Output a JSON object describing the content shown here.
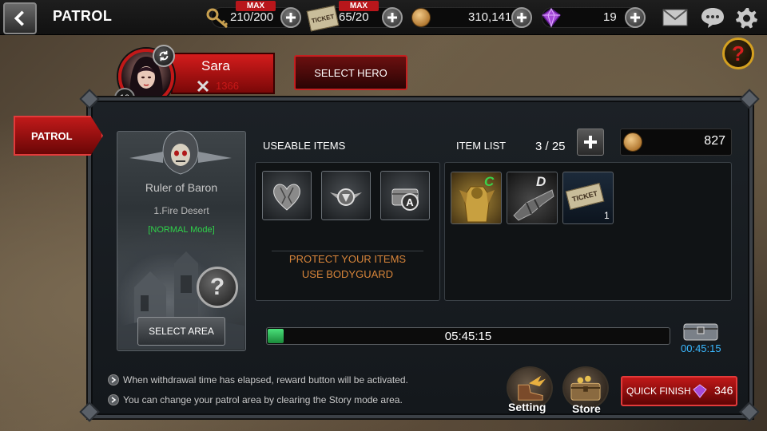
{
  "header": {
    "title": "PATROL",
    "keys": {
      "value": "210/200",
      "max_label": "MAX"
    },
    "tickets": {
      "value": "65/20",
      "max_label": "MAX",
      "icon_text": "TICKET"
    },
    "gold": {
      "value": "310,141"
    },
    "gems": {
      "value": "19"
    }
  },
  "hero": {
    "name": "Sara",
    "power": "1366",
    "level": "10",
    "select_label": "SELECT HERO"
  },
  "side_tab": {
    "label": "PATROL"
  },
  "area": {
    "boss_name": "Ruler of Baron",
    "stage": "1.Fire Desert",
    "mode": "[NORMAL Mode]",
    "help_glyph": "?",
    "select_label": "SELECT AREA"
  },
  "useable_items": {
    "label": "USEABLE ITEMS",
    "protect_line1": "PROTECT YOUR ITEMS",
    "protect_line2": "USE BODYGUARD"
  },
  "item_list": {
    "label": "ITEM LIST",
    "count": "3 / 25",
    "gold": "827",
    "items": [
      {
        "badge": "C",
        "qty": ""
      },
      {
        "badge": "D",
        "qty": ""
      },
      {
        "badge": "TICKET",
        "qty": "1"
      }
    ]
  },
  "progress": {
    "time": "05:45:15",
    "fill_fraction": 0.04,
    "chest_time": "00:45:15"
  },
  "info": {
    "line1": "When withdrawal time has elapsed, reward button will be activated.",
    "line2": "You can change your patrol area by clearing the Story mode area."
  },
  "buttons": {
    "setting_label": "Setting",
    "store_label": "Store",
    "quick_finish_label": "QUICK FINISH",
    "quick_finish_cost": "346"
  },
  "colors": {
    "accent_red": "#c01818",
    "mode_green": "#2fd24a",
    "protect_orange": "#d8853a",
    "timer_blue": "#3ab8ff"
  }
}
